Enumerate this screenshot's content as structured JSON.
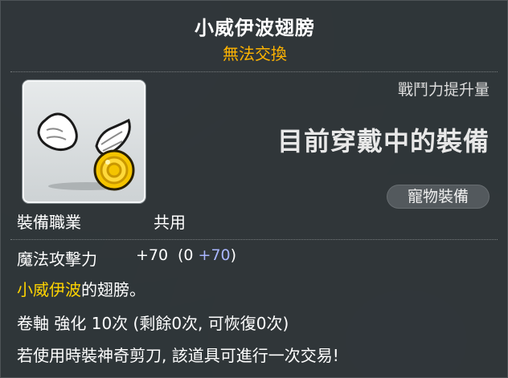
{
  "item": {
    "name": "小威伊波翅膀",
    "trade_status": "無法交換",
    "power_label": "戰鬥力提升量",
    "equipped_label": "目前穿戴中的裝備",
    "category_badge": "寵物裝備",
    "job_label": "裝備職業",
    "job_value": "共用",
    "stat": {
      "name": "魔法攻擊力",
      "total": "+70",
      "paren_open": "(0 ",
      "bonus": "+70",
      "paren_close": ")"
    },
    "description": {
      "highlight": "小威伊波",
      "rest": "的翅膀。"
    },
    "upgrade_line": "卷軸 強化 10次 (剩餘0次, 可恢復0次)",
    "scissors_line": "若使用時裝神奇剪刀, 該道具可進行一次交易!"
  },
  "colors": {
    "trade_status": "#ffb400",
    "highlight": "#ffd400",
    "bonus": "#a9b6ff",
    "badge_bg": "#53595d"
  },
  "icons": {
    "item_icon": "winged-gold-coin-icon"
  }
}
